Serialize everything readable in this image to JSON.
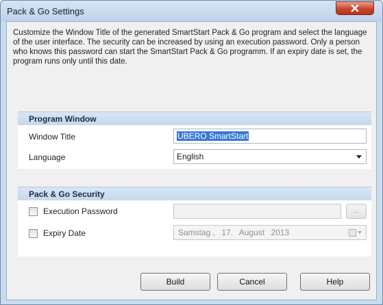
{
  "window": {
    "title": "Pack & Go Settings"
  },
  "description": "Customize the Window Title of the generated SmartStart Pack & Go program and select the language of the user interface. The security can be increased by using an execution password. Only a person who knows this password can start the SmartStart Pack & Go programm. If an expiry date is set, the program runs only until this date.",
  "program_window": {
    "header": "Program Window",
    "window_title_label": "Window Title",
    "window_title_value": "UBERO SmartStart",
    "language_label": "Language",
    "language_value": "English"
  },
  "security": {
    "header": "Pack & Go Security",
    "execution_password_label": "Execution Password",
    "execution_password_checked": false,
    "password_value": "",
    "ellipsis_label": "...",
    "expiry_date_label": "Expiry Date",
    "expiry_date_checked": false,
    "date_weekday": "Samstag ,",
    "date_day": "17.",
    "date_month": "August",
    "date_year": "2013"
  },
  "buttons": {
    "build": "Build",
    "cancel": "Cancel",
    "help": "Help"
  },
  "colors": {
    "group_header": "#c6d8ec",
    "selection": "#3a78d4",
    "close_button": "#c9452f"
  }
}
